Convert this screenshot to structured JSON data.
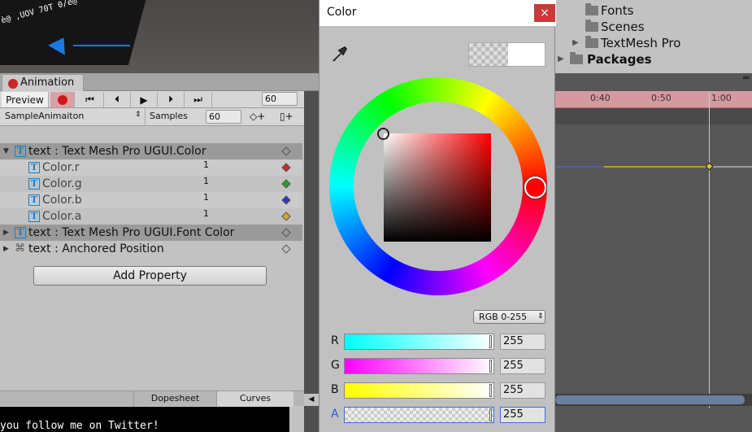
{
  "project": {
    "items": [
      {
        "label": "Fonts"
      },
      {
        "label": "Scenes"
      },
      {
        "label": "TextMesh Pro"
      },
      {
        "label": "Packages"
      }
    ]
  },
  "scene": {
    "overlay_text": "è@ ,UOV 70T 0/è@"
  },
  "animation": {
    "tab_label": "Animation",
    "preview_label": "Preview",
    "frame_value": "60",
    "clip_name": "SampleAnimaiton",
    "samples_label": "Samples",
    "samples_value": "60"
  },
  "properties": [
    {
      "label": "text : Text Mesh Pro UGUI.Color",
      "expanded": true
    },
    {
      "label": "Color.r",
      "value": "1",
      "color": "#cc2a2a"
    },
    {
      "label": "Color.g",
      "value": "1",
      "color": "#2aa02a"
    },
    {
      "label": "Color.b",
      "value": "1",
      "color": "#2a3ac0"
    },
    {
      "label": "Color.a",
      "value": "1",
      "color": "#d6a82a"
    },
    {
      "label": "text : Text Mesh Pro UGUI.Font Color",
      "expanded": false
    },
    {
      "label": "text : Anchored Position",
      "expanded": false
    }
  ],
  "add_property_label": "Add Property",
  "bottom_tabs": {
    "dopesheet": "Dopesheet",
    "curves": "Curves"
  },
  "console_text": "you follow me on Twitter!",
  "timeline": {
    "ticks": [
      "0:40",
      "0:50",
      "1:00"
    ]
  },
  "color_picker": {
    "title": "Color",
    "close": "×",
    "mode": "RGB 0-255",
    "channels": [
      {
        "label": "R",
        "value": "255"
      },
      {
        "label": "G",
        "value": "255"
      },
      {
        "label": "B",
        "value": "255"
      },
      {
        "label": "A",
        "value": "255"
      }
    ],
    "current_color": "#ffffff",
    "hue_color": "#ff0000"
  }
}
